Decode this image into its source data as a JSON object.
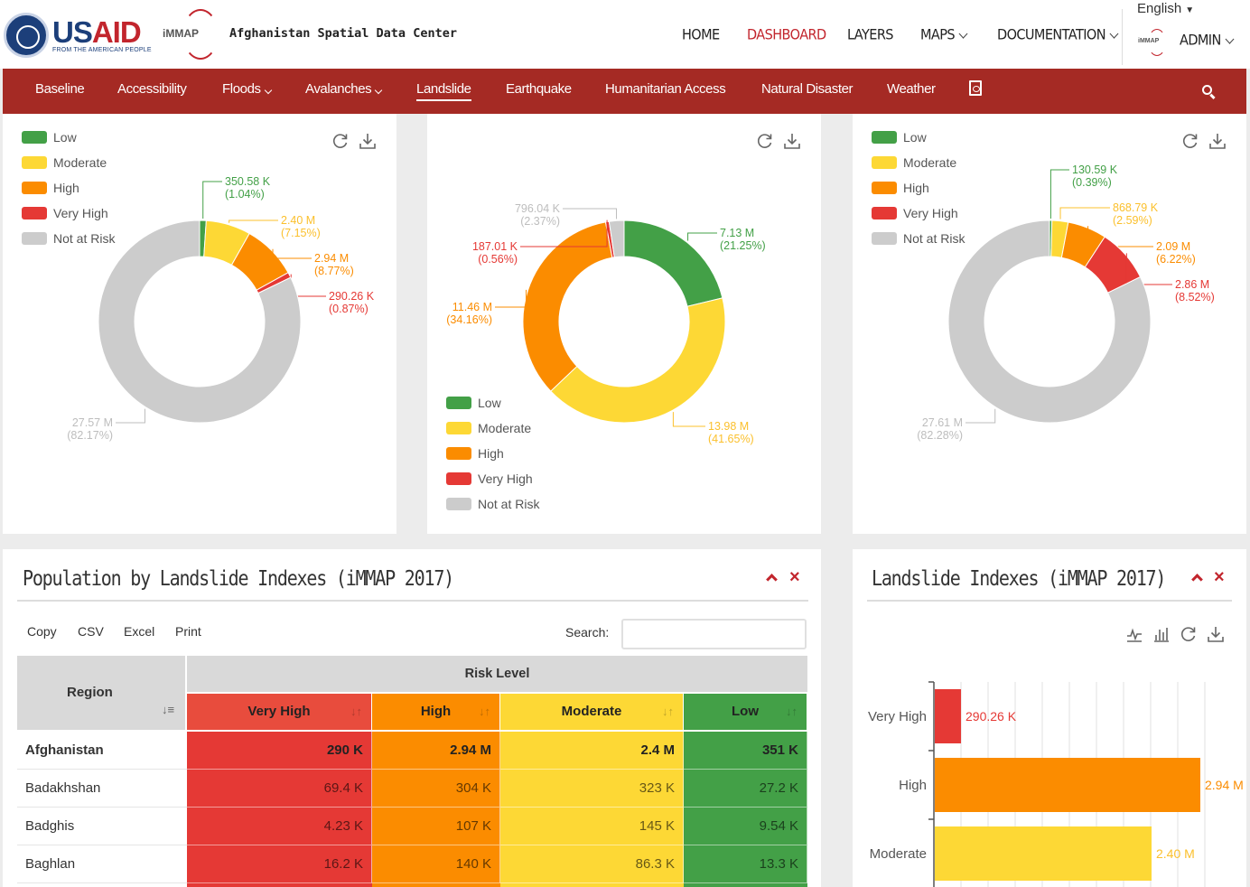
{
  "header": {
    "usaid_word_us": "US",
    "usaid_word_aid": "AID",
    "usaid_tagline": "FROM THE AMERICAN PEOPLE",
    "immap_logo": "iMMAP",
    "site_title": "Afghanistan Spatial Data Center",
    "nav": [
      {
        "label": "HOME"
      },
      {
        "label": "DASHBOARD"
      },
      {
        "label": "LAYERS"
      },
      {
        "label": "MAPS"
      },
      {
        "label": "DOCUMENTATION"
      }
    ],
    "language": "English",
    "language_caret": "▼",
    "user": "ADMIN",
    "accent": "#c2252d"
  },
  "subnav": {
    "items": [
      {
        "label": "Baseline"
      },
      {
        "label": "Accessibility"
      },
      {
        "label": "Floods"
      },
      {
        "label": "Avalanches"
      },
      {
        "label": "Landslide"
      },
      {
        "label": "Earthquake"
      },
      {
        "label": "Humanitarian Access"
      },
      {
        "label": "Natural Disaster"
      },
      {
        "label": "Weather"
      }
    ],
    "background": "#a52a24"
  },
  "legend": [
    "Low",
    "Moderate",
    "High",
    "Very High",
    "Not at Risk"
  ],
  "colors": {
    "low": "#43a047",
    "moderate": "#fdd835",
    "high": "#fb8c00",
    "very_high": "#e53935",
    "not_at_risk": "#cccccc"
  },
  "chart_data": [
    {
      "type": "pie",
      "variant": "donut",
      "categories": [
        "Low",
        "Moderate",
        "High",
        "Very High",
        "Not at Risk"
      ],
      "values": [
        350580,
        2400000,
        2940000,
        290260,
        27570000
      ],
      "percent": [
        1.04,
        7.15,
        8.77,
        0.87,
        82.17
      ],
      "labels": [
        "350.58 K",
        "2.40 M",
        "2.94 M",
        "290.26 K",
        "27.57 M"
      ],
      "pct_labels": [
        "(1.04%)",
        "(7.15%)",
        "(8.77%)",
        "(0.87%)",
        "(82.17%)"
      ],
      "legend_position": "top-left"
    },
    {
      "type": "pie",
      "variant": "donut",
      "categories": [
        "Low",
        "Moderate",
        "High",
        "Very High",
        "Not at Risk"
      ],
      "values": [
        7130000,
        13980000,
        11460000,
        187010,
        796040
      ],
      "percent": [
        21.25,
        41.65,
        34.16,
        0.56,
        2.37
      ],
      "labels": [
        "7.13 M",
        "13.98 M",
        "11.46 M",
        "187.01 K",
        "796.04 K"
      ],
      "pct_labels": [
        "(21.25%)",
        "(41.65%)",
        "(34.16%)",
        "(0.56%)",
        "(2.37%)"
      ],
      "legend_position": "bottom-left"
    },
    {
      "type": "pie",
      "variant": "donut",
      "categories": [
        "Low",
        "Moderate",
        "High",
        "Very High",
        "Not at Risk"
      ],
      "values": [
        130590,
        868790,
        2090000,
        2860000,
        27610000
      ],
      "percent": [
        0.39,
        2.59,
        6.22,
        8.52,
        82.28
      ],
      "labels": [
        "130.59 K",
        "868.79 K",
        "2.09 M",
        "2.86 M",
        "27.61 M"
      ],
      "pct_labels": [
        "(0.39%)",
        "(2.59%)",
        "(6.22%)",
        "(8.52%)",
        "(82.28%)"
      ],
      "legend_position": "top-left"
    },
    {
      "type": "bar",
      "orientation": "horizontal",
      "title": "Landslide Indexes (iMMAP 2017)",
      "categories": [
        "Very High",
        "High",
        "Moderate"
      ],
      "values": [
        290260,
        2940000,
        2400000
      ],
      "labels": [
        "290.26 K",
        "2.94 M",
        "2.40 M"
      ],
      "xlim": [
        0,
        3000000
      ],
      "grid": true
    }
  ],
  "table": {
    "title": "Population by Landslide Indexes (iMMAP 2017)",
    "buttons": [
      "Copy",
      "CSV",
      "Excel",
      "Print"
    ],
    "search_label": "Search:",
    "search_value": "",
    "region_header": "Region",
    "risk_header": "Risk Level",
    "columns": [
      "Very High",
      "High",
      "Moderate",
      "Low"
    ],
    "rows": [
      {
        "region": "Afghanistan",
        "values": [
          "290 K",
          "2.94 M",
          "2.4 M",
          "351 K"
        ]
      },
      {
        "region": "Badakhshan",
        "values": [
          "69.4 K",
          "304 K",
          "323 K",
          "27.2 K"
        ]
      },
      {
        "region": "Badghis",
        "values": [
          "4.23 K",
          "107 K",
          "145 K",
          "9.54 K"
        ]
      },
      {
        "region": "Baghlan",
        "values": [
          "16.2 K",
          "140 K",
          "86.3 K",
          "13.3 K"
        ]
      }
    ]
  },
  "bar_panel": {
    "title": "Landslide Indexes (iMMAP 2017)"
  }
}
